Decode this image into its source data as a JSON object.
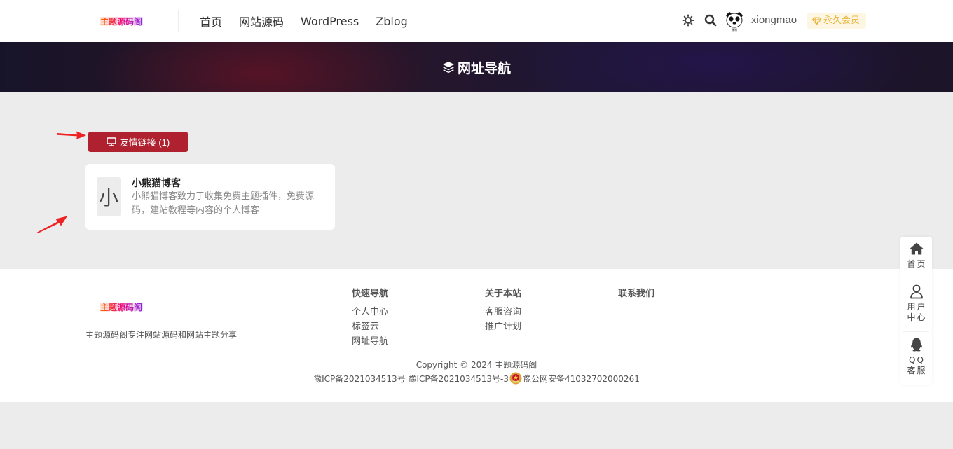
{
  "header": {
    "logo_text": "主题源码阁",
    "nav": [
      "首页",
      "网站源码",
      "WordPress",
      "Zblog"
    ],
    "theme_icon": "sun-icon",
    "search_icon": "search-icon",
    "avatar_icon": "panda-avatar-icon",
    "username": "xiongmao",
    "vip_label": "永久会员",
    "vip_color": "#e8b53a"
  },
  "banner": {
    "title": "网址导航",
    "icon": "layers-icon"
  },
  "links_section": {
    "category_label": "友情链接 (1)",
    "category_color": "#b0212f",
    "card": {
      "thumb_char": "小",
      "title": "小熊猫博客",
      "description": "小熊猫博客致力于收集免费主题插件，免费源码，建站教程等内容的个人博客"
    }
  },
  "footer": {
    "logo_text": "主题源码阁",
    "description": "主题源码阁专注网站源码和网站主题分享",
    "columns": [
      {
        "title": "快速导航",
        "links": [
          "个人中心",
          "标签云",
          "网址导航"
        ]
      },
      {
        "title": "关于本站",
        "links": [
          "客服咨询",
          "推广计划"
        ]
      },
      {
        "title": "联系我们",
        "links": []
      }
    ],
    "copyright": "Copyright © 2024 主题源码阁",
    "icp_1": "豫ICP备2021034513号",
    "icp_2": "豫ICP备2021034513号-3",
    "police": "豫公网安备41032702000261"
  },
  "sidebar": {
    "items": [
      {
        "icon": "home-icon",
        "label": "首页"
      },
      {
        "icon": "user-icon",
        "label": "用户中心"
      },
      {
        "icon": "qq-icon",
        "label": "QQ客服"
      }
    ]
  }
}
